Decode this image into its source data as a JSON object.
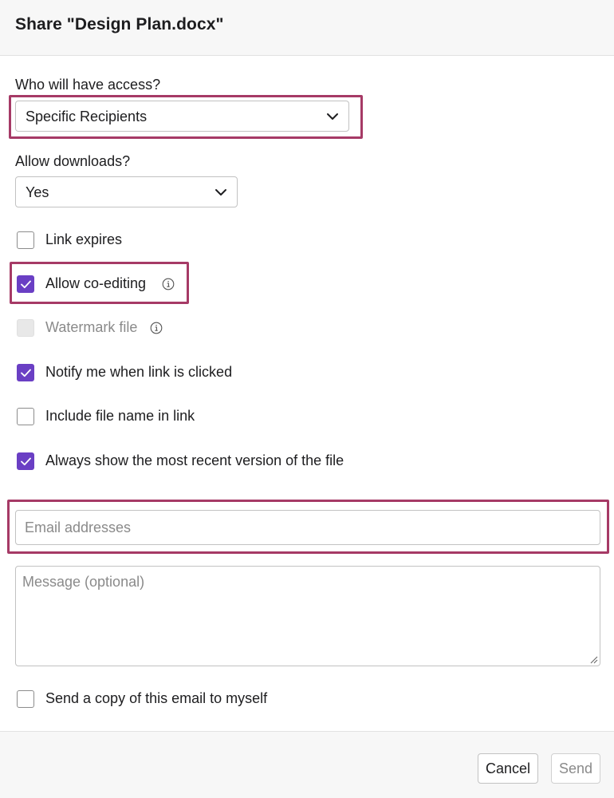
{
  "dialog": {
    "title": "Share \"Design Plan.docx\""
  },
  "access": {
    "label": "Who will have access?",
    "value": "Specific Recipients"
  },
  "downloads": {
    "label": "Allow downloads?",
    "value": "Yes"
  },
  "options": [
    {
      "label": "Link expires",
      "checked": false,
      "disabled": false
    },
    {
      "label": "Allow co-editing",
      "checked": true,
      "disabled": false,
      "info_icon": "info-icon"
    },
    {
      "label": "Watermark file",
      "checked": false,
      "disabled": true,
      "info_icon": "info-icon"
    },
    {
      "label": "Notify me when link is clicked",
      "checked": true,
      "disabled": false
    },
    {
      "label": "Include file name in link",
      "checked": false,
      "disabled": false
    },
    {
      "label": "Always show the most recent version of the file",
      "checked": true,
      "disabled": false
    }
  ],
  "email": {
    "placeholder": "Email addresses"
  },
  "message": {
    "placeholder": "Message (optional)"
  },
  "send_copy": {
    "label": "Send a copy of this email to myself",
    "checked": false
  },
  "buttons": {
    "cancel": "Cancel",
    "send": "Send"
  },
  "colors": {
    "accent": "#6a3fc4",
    "highlight": "#a63a66"
  }
}
